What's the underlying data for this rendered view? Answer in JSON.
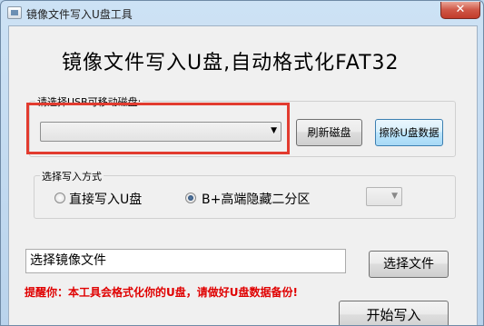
{
  "window": {
    "title": "镜像文件写入U盘工具",
    "close_glyph": "✕"
  },
  "main": {
    "heading": "镜像文件写入U盘,自动格式化FAT32",
    "usb_group": {
      "legend": "请选择USB可移动磁盘:",
      "disk_select_value": "",
      "refresh_button": "刷新磁盘",
      "erase_button": "擦除U盘数据"
    },
    "write_mode_group": {
      "legend": "选择写入方式",
      "options": [
        {
          "label": "直接写入U盘",
          "selected": false
        },
        {
          "label": "B+高端隐藏二分区",
          "selected": true
        }
      ],
      "partition_select_value": ""
    },
    "image_file": {
      "field_value": "选择镜像文件",
      "select_button": "选择文件"
    },
    "start_button": "开始写入",
    "warning": "提醒你：本工具会格式化你的U盘，请做好U盘数据备份!"
  },
  "colors": {
    "highlight": "#e23b2f",
    "warning_text": "#e00000"
  }
}
